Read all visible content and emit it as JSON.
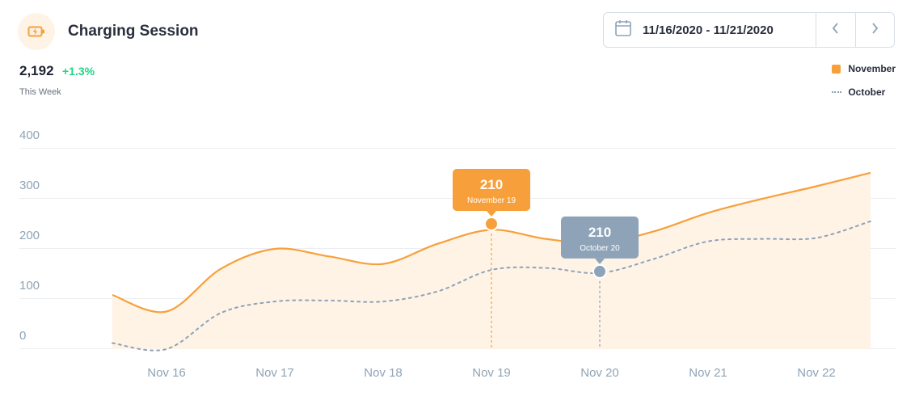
{
  "header": {
    "title": "Charging Session",
    "icon": "battery-charging-icon"
  },
  "stats": {
    "value": "2,192",
    "delta": "+1.3%",
    "period": "This Week"
  },
  "date_picker": {
    "range": "11/16/2020 - 11/21/2020",
    "icon": "calendar-icon",
    "prev_icon": "chevron-left-icon",
    "next_icon": "chevron-right-icon"
  },
  "legend": {
    "november": "November",
    "october": "October"
  },
  "colors": {
    "november": "#f7a03b",
    "november_fill": "#fff3e6",
    "october": "#8ea3b8",
    "grid": "#eceef2",
    "tick": "#8fa3b6",
    "accent": "#f7a03b",
    "positive": "#22d486"
  },
  "chart_data": {
    "type": "area",
    "categories": [
      "Nov 16",
      "Nov 17",
      "Nov 18",
      "Nov 19",
      "Nov 20",
      "Nov 21",
      "Nov 22"
    ],
    "y_ticks": [
      "400",
      "300",
      "200",
      "100",
      "0"
    ],
    "ylim": [
      0,
      400
    ],
    "grid": true,
    "legend_position": "top-right",
    "series": [
      {
        "name": "November",
        "style": "solid line with filled area",
        "x": [
          -0.5,
          0,
          0.5,
          1,
          1.5,
          2,
          2.5,
          3,
          3.5,
          4,
          4.5,
          5,
          5.5,
          6,
          6.5
        ],
        "values": [
          108,
          75,
          160,
          200,
          185,
          170,
          210,
          238,
          220,
          212,
          235,
          272,
          300,
          325,
          352
        ]
      },
      {
        "name": "October",
        "style": "dotted line",
        "x": [
          -0.5,
          0,
          0.5,
          1,
          1.5,
          2,
          2.5,
          3,
          3.5,
          4,
          4.5,
          5,
          5.5,
          6,
          6.5
        ],
        "values": [
          12,
          0,
          72,
          95,
          97,
          95,
          115,
          158,
          162,
          152,
          180,
          215,
          220,
          222,
          255
        ]
      }
    ],
    "tooltips": [
      {
        "series": "November",
        "value": "210",
        "label": "November 19",
        "x": 3,
        "y": 250
      },
      {
        "series": "October",
        "value": "210",
        "label": "October 20",
        "x": 4,
        "y": 155
      }
    ]
  }
}
